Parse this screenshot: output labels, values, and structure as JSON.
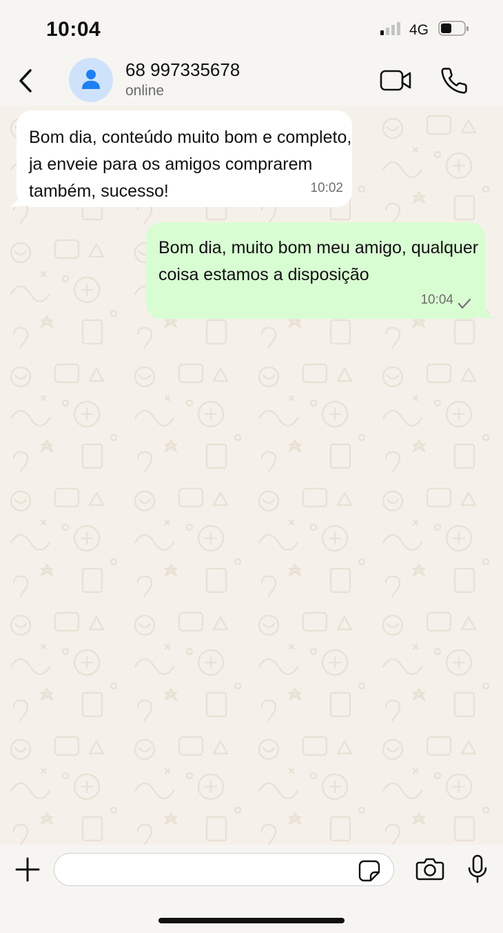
{
  "status_bar": {
    "time": "10:04",
    "network": "4G",
    "signal_bars_active": 1,
    "signal_bars_total": 4,
    "battery_level": 0.45
  },
  "header": {
    "contact_name": "68 997335678",
    "contact_status": "online",
    "icons": {
      "back": "chevron-left",
      "avatar": "person",
      "video": "video-camera",
      "call": "phone"
    }
  },
  "messages": [
    {
      "direction": "incoming",
      "text": "Bom dia, conteúdo muito bom e completo, ja enveie para os amigos comprarem também, sucesso!",
      "time": "10:02"
    },
    {
      "direction": "outgoing",
      "text": "Bom dia, muito bom meu amigo, qualquer coisa estamos a disposição",
      "time": "10:04",
      "status": "sent"
    }
  ],
  "composer": {
    "input_value": "",
    "input_placeholder": "",
    "icons": {
      "attach": "plus",
      "sticker": "sticker",
      "camera": "camera",
      "mic": "microphone"
    }
  },
  "colors": {
    "incoming_bubble": "#ffffff",
    "outgoing_bubble": "#d9fdd3",
    "chat_background": "#f5f1ea",
    "avatar_background": "#cfe2fb",
    "avatar_icon": "#1e7ff2"
  }
}
